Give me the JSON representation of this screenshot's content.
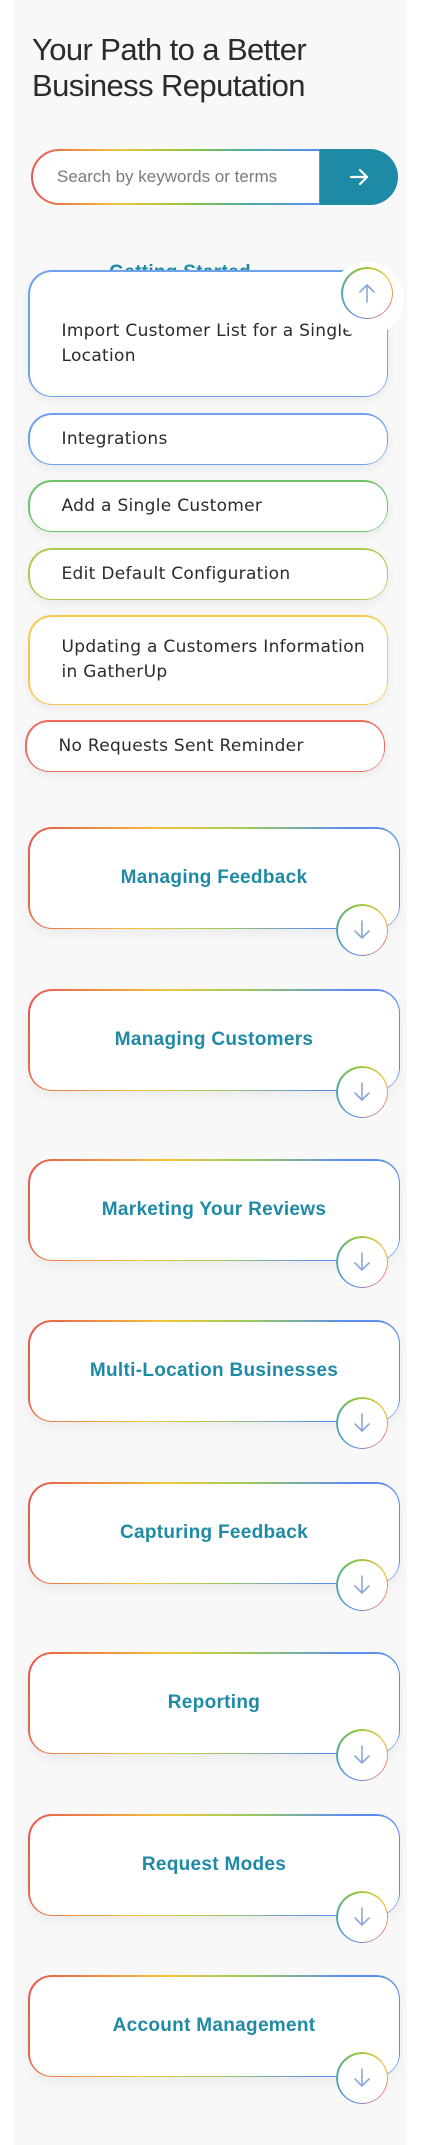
{
  "hero": {
    "title": "Your Path to a Better Business Reputation"
  },
  "search": {
    "placeholder": "Search by keywords or terms"
  },
  "colors": {
    "accent": "#1f8aa6",
    "background": "#f8f8f8"
  },
  "getting_started": {
    "title": "Getting Started",
    "toggle_icon": "arrow-up-icon",
    "items": [
      {
        "label": "Import Customer List for a Single Location"
      },
      {
        "label": "Integrations"
      },
      {
        "label": "Add a Single Customer"
      },
      {
        "label": "Edit Default Configuration"
      },
      {
        "label": "Updating a Customers Information in GatherUp"
      },
      {
        "label": "No Requests Sent Reminder"
      }
    ]
  },
  "sections": [
    {
      "title": "Managing Feedback",
      "toggle_icon": "arrow-down-icon"
    },
    {
      "title": "Managing Customers",
      "toggle_icon": "arrow-down-icon"
    },
    {
      "title": "Marketing Your Reviews",
      "toggle_icon": "arrow-down-icon"
    },
    {
      "title": "Multi-Location Businesses",
      "toggle_icon": "arrow-down-icon"
    },
    {
      "title": "Capturing Feedback",
      "toggle_icon": "arrow-down-icon"
    },
    {
      "title": "Reporting",
      "toggle_icon": "arrow-down-icon"
    },
    {
      "title": "Request Modes",
      "toggle_icon": "arrow-down-icon"
    },
    {
      "title": "Account Management",
      "toggle_icon": "arrow-down-icon"
    }
  ]
}
